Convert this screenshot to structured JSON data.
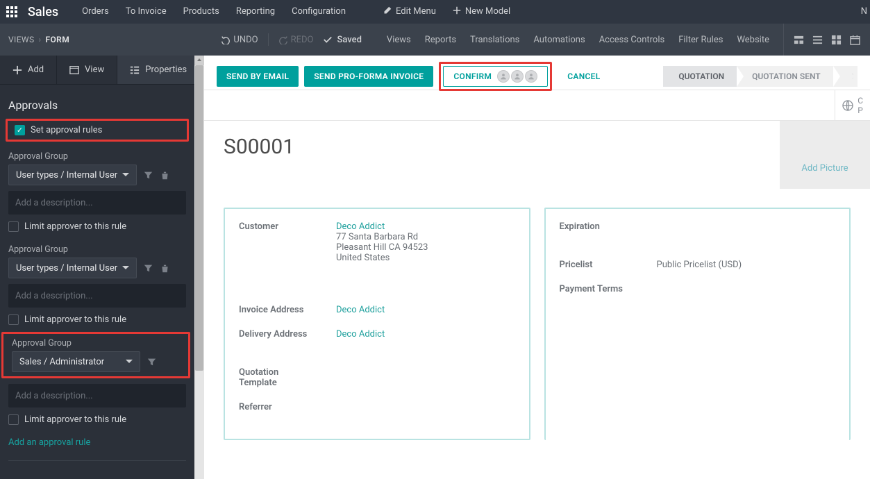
{
  "topbar": {
    "brand": "Sales",
    "nav": [
      "Orders",
      "To Invoice",
      "Products",
      "Reporting",
      "Configuration"
    ],
    "edit_menu": "Edit Menu",
    "new_model": "New Model",
    "right_letter": "N"
  },
  "secondbar": {
    "crumb1": "VIEWS",
    "crumb2": "FORM",
    "undo": "UNDO",
    "redo": "REDO",
    "saved": "Saved",
    "subnav": [
      "Views",
      "Reports",
      "Translations",
      "Automations",
      "Access Controls",
      "Filter Rules",
      "Website"
    ]
  },
  "left": {
    "tabs": {
      "add": "Add",
      "view": "View",
      "properties": "Properties"
    },
    "section_title": "Approvals",
    "set_approval_rules": "Set approval rules",
    "groups": [
      {
        "label": "Approval Group",
        "select": "User types / Internal User",
        "desc_ph": "Add a description...",
        "limit": "Limit approver to this rule"
      },
      {
        "label": "Approval Group",
        "select": "User types / Internal User",
        "desc_ph": "Add a description...",
        "limit": "Limit approver to this rule"
      },
      {
        "label": "Approval Group",
        "select": "Sales / Administrator",
        "desc_ph": "Add a description...",
        "limit": "Limit approver to this rule"
      }
    ],
    "add_rule": "Add an approval rule"
  },
  "main": {
    "buttons": {
      "send_email": "SEND BY EMAIL",
      "send_proforma": "SEND PRO-FORMA INVOICE",
      "confirm": "CONFIRM",
      "cancel": "CANCEL"
    },
    "stages": {
      "quotation": "QUOTATION",
      "quotation_sent": "QUOTATION SENT",
      "sale_trunc": "S"
    },
    "globe_line1": "C",
    "globe_line2": "P",
    "title": "S00001",
    "add_picture": "Add Picture",
    "left_col": {
      "customer_label": "Customer",
      "customer_link": "Deco Addict",
      "addr1": "77 Santa Barbara Rd",
      "addr2": "Pleasant Hill CA 94523",
      "addr3": "United States",
      "invoice_label": "Invoice Address",
      "invoice_link": "Deco Addict",
      "delivery_label": "Delivery Address",
      "delivery_link": "Deco Addict",
      "qt_label1": "Quotation",
      "qt_label2": "Template",
      "referrer_label": "Referrer"
    },
    "right_col": {
      "expiration_label": "Expiration",
      "pricelist_label": "Pricelist",
      "pricelist_value": "Public Pricelist (USD)",
      "payment_label": "Payment Terms"
    }
  }
}
